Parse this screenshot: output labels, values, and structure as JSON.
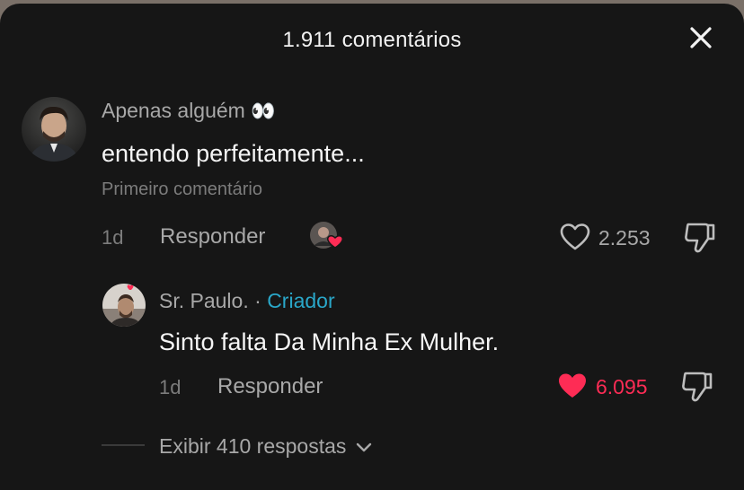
{
  "header": {
    "title": "1.911 comentários"
  },
  "comments": [
    {
      "username": "Apenas alguém",
      "username_emoji": "👀",
      "text": "entendo perfeitamente...",
      "note": "Primeiro comentário",
      "time": "1d",
      "reply_label": "Responder",
      "likes": "2.253",
      "liked": false
    }
  ],
  "reply": {
    "username": "Sr. Paulo.",
    "separator": "·",
    "badge": "Criador",
    "text": "Sinto falta Da Minha Ex Mulher.",
    "time": "1d",
    "reply_label": "Responder",
    "likes": "6.095",
    "liked": true
  },
  "view_replies": {
    "label": "Exibir 410 respostas"
  },
  "colors": {
    "like_active": "#fe2c55",
    "creator_badge": "#2aa7c9",
    "background": "#161616"
  },
  "icons": [
    "close-icon",
    "heart-icon",
    "dislike-icon",
    "chevron-down-icon"
  ]
}
